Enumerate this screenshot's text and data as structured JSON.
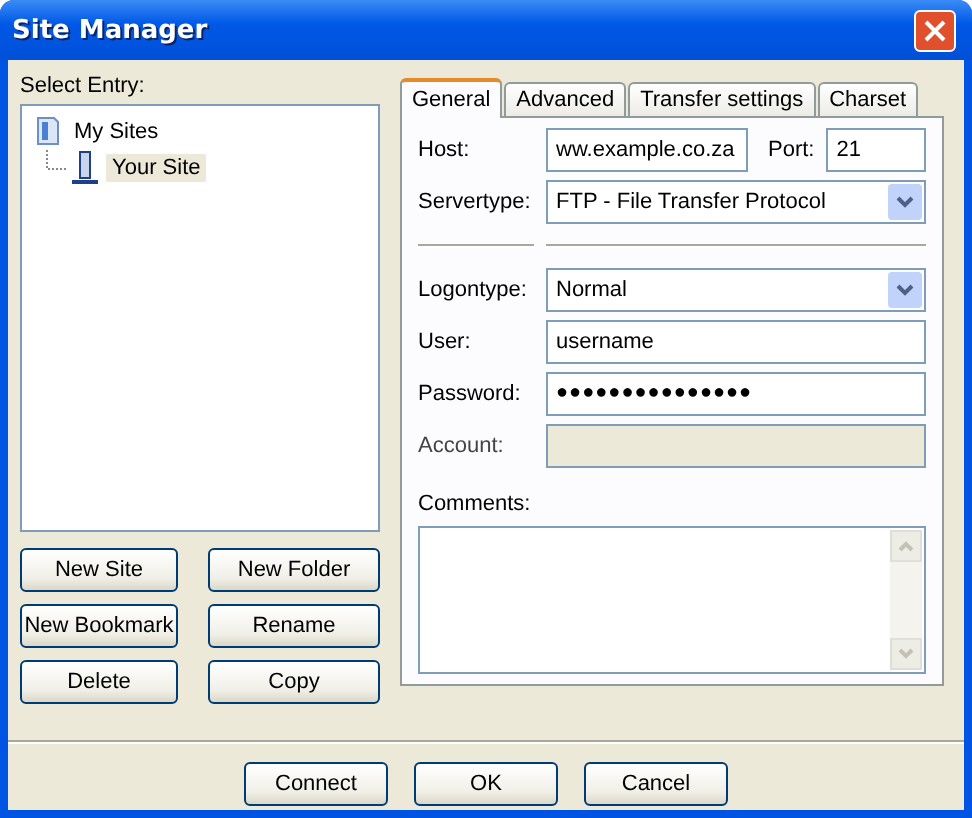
{
  "window": {
    "title": "Site Manager"
  },
  "select_entry_label": "Select Entry:",
  "tree": [
    {
      "label": "My Sites",
      "kind": "folder",
      "selected": false,
      "expanded": true,
      "children": [
        {
          "label": "Your Site",
          "kind": "site",
          "selected": true
        }
      ]
    }
  ],
  "entry_buttons": [
    "New Site",
    "New Folder",
    "New Bookmark",
    "Rename",
    "Delete",
    "Copy"
  ],
  "tabs": [
    {
      "label": "General",
      "selected": true
    },
    {
      "label": "Advanced",
      "selected": false
    },
    {
      "label": "Transfer settings",
      "selected": false
    },
    {
      "label": "Charset",
      "selected": false
    }
  ],
  "general": {
    "host": {
      "label": "Host:",
      "value": "ww.example.co.za"
    },
    "port": {
      "label": "Port:",
      "value": "21"
    },
    "servertype": {
      "label": "Servertype:",
      "value": "FTP - File Transfer Protocol"
    },
    "logontype": {
      "label": "Logontype:",
      "value": "Normal"
    },
    "user": {
      "label": "User:",
      "value": "username"
    },
    "password": {
      "label": "Password:",
      "value": "●●●●●●●●●●●●●●●"
    },
    "account": {
      "label": "Account:",
      "disabled": true
    },
    "comments": {
      "label": "Comments:"
    }
  },
  "buttons": [
    "Connect",
    "OK",
    "Cancel"
  ]
}
